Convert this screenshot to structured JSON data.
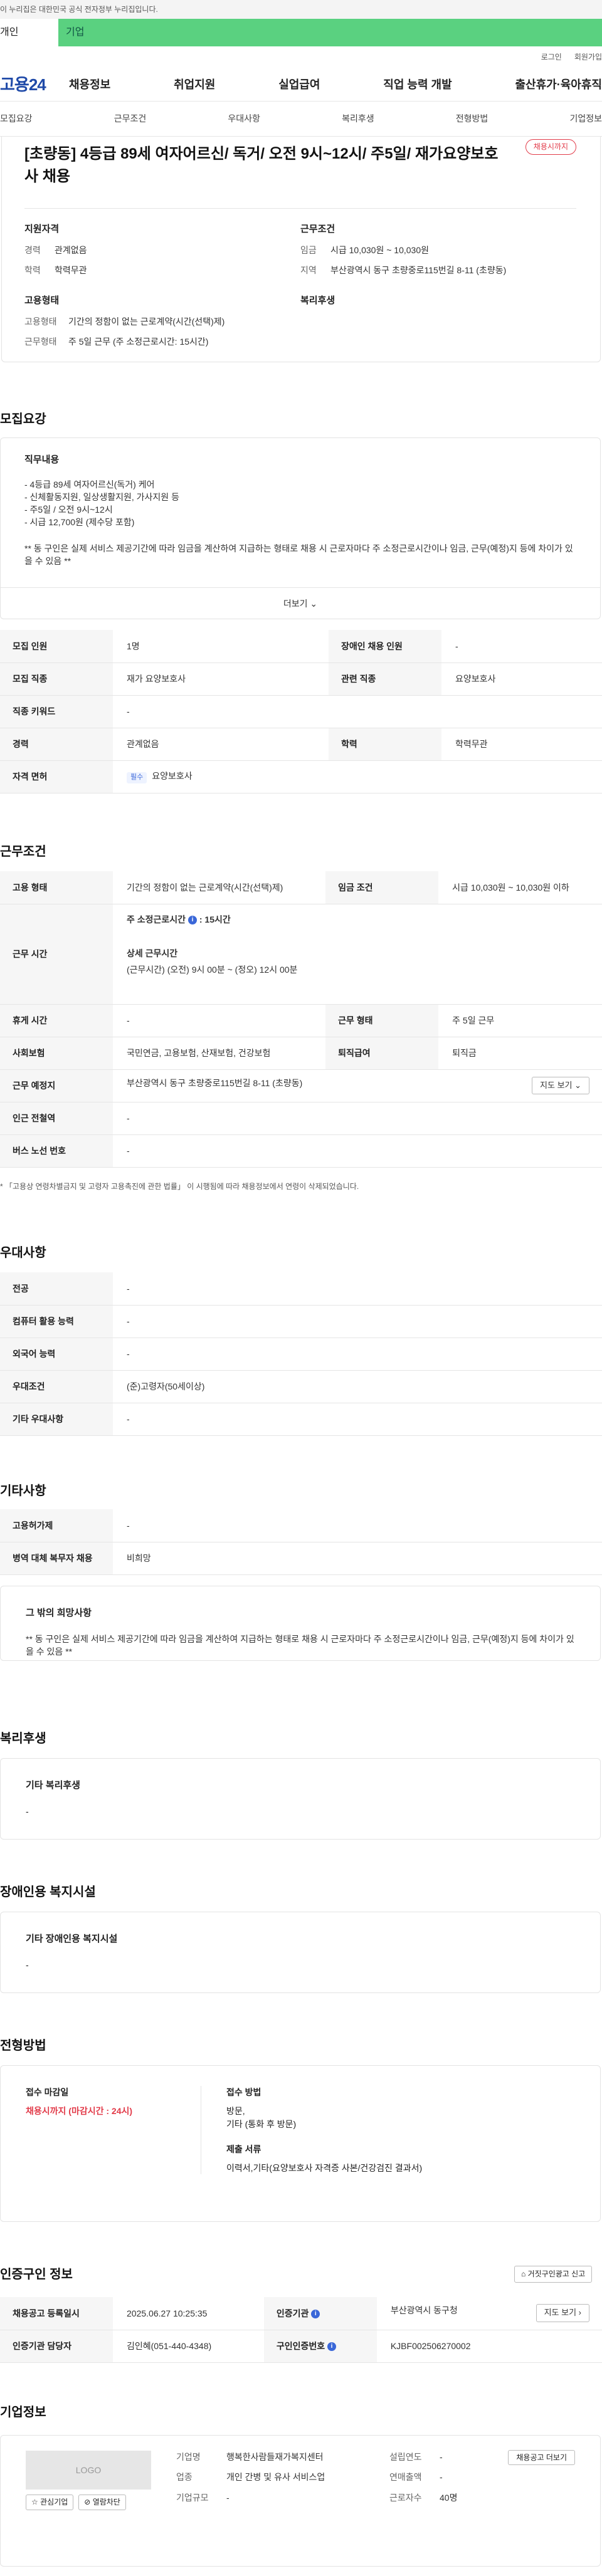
{
  "gov_banner": "이 누리집은 대한민국 공식 전자정부 누리집입니다.",
  "usertype": {
    "individual": "개인",
    "business": "기업"
  },
  "util": {
    "login": "로그인",
    "join": "회원가입"
  },
  "gnb": {
    "logo": "고용24",
    "menu": [
      "채용정보",
      "취업지원",
      "실업급여",
      "직업 능력 개발",
      "출산휴가·육아휴직"
    ]
  },
  "subnav": [
    "모집요강",
    "근무조건",
    "우대사항",
    "복리후생",
    "전형방법",
    "기업정보"
  ],
  "hero": {
    "title": "[초량동] 4등급 89세 여자어르신/ 독거/ 오전 9시~12시/ 주5일/ 재가요양보호사 채용",
    "badge": "채용시까지",
    "applicant": {
      "heading": "지원자격",
      "rows": [
        {
          "k": "경력",
          "v": "관계없음"
        },
        {
          "k": "학력",
          "v": "학력무관"
        }
      ]
    },
    "condition": {
      "heading": "근무조건",
      "rows": [
        {
          "k": "임금",
          "v": "시급 10,030원 ~ 10,030원"
        },
        {
          "k": "지역",
          "v": "부산광역시 동구 초량중로115번길 8-11 (초량동)"
        }
      ]
    },
    "employ": {
      "heading": "고용형태",
      "rows": [
        {
          "k": "고용형태",
          "v": "기간의 정함이 없는 근로계약(시간(선택)제)"
        },
        {
          "k": "근무형태",
          "v": "주 5일 근무 (주 소정근로시간: 15시간)"
        }
      ]
    },
    "welfare": {
      "heading": "복리후생"
    }
  },
  "recruit": {
    "title": "모집요강",
    "job_desc_title": "직무내용",
    "job_desc_lines": [
      "- 4등급 89세 여자어르신(독거) 케어",
      "- 신체활동지원, 일상생활지원, 가사지원 등",
      "- 주5일 / 오전 9시~12시",
      "- 시급 12,700원 (제수당 포함)",
      "",
      "** 동 구인은 실제 서비스 제공기간에 따라 임금을 계산하여 지급하는 형태로 채용 시 근로자마다 주 소정근로시간이나 임금, 근무(예정)지 등에 차이가 있을 수 있음 **"
    ],
    "more": "더보기",
    "table": [
      {
        "k1": "모집 인원",
        "v1": "1명",
        "k2": "장애인 채용 인원",
        "v2": "-"
      },
      {
        "k1": "모집 직종",
        "v1": "재가 요양보호사",
        "k2": "관련 직종",
        "v2": "요양보호사"
      },
      {
        "k1": "직종 키워드",
        "v1": "-"
      },
      {
        "k1": "경력",
        "v1": "관계없음",
        "k2": "학력",
        "v2": "학력무관"
      },
      {
        "k1": "자격 면허",
        "tag": "필수",
        "v1": "요양보호사"
      }
    ]
  },
  "work": {
    "title": "근무조건",
    "employ_type_k": "고용 형태",
    "employ_type_v": "기간의 정함이 없는 근로계약(시간(선택)제)",
    "wage_k": "임금 조건",
    "wage_v": "시급 10,030원 ~ 10,030원 이하",
    "hours_k": "근무 시간",
    "hours_weekly_label": "주 소정근로시간",
    "hours_weekly_value": "15시간",
    "hours_detail_label": "상세 근무시간",
    "hours_detail_value": "(근무시간) (오전) 9시 00분 ~ (정오) 12시 00분",
    "rest_k": "휴게 시간",
    "rest_v": "-",
    "form_k": "근무 형태",
    "form_v": "주 5일 근무",
    "insurance_k": "사회보험",
    "insurance_v": "국민연금, 고용보험, 산재보험, 건강보험",
    "severance_k": "퇴직급여",
    "severance_v": "퇴직금",
    "place_k": "근무 예정지",
    "place_v": "부산광역시 동구 초량중로115번길 8-11 (초량동)",
    "map_btn": "지도 보기",
    "industry_k": "인근 전철역",
    "industry_v": "-",
    "bus_k": "버스 노선 번호",
    "bus_v": "-",
    "note": "* 「고용상 연령차별금지 및 고령자 고용촉진에 관한 법률」 이 시행됨에 따라 채용정보에서 연령이 삭제되었습니다."
  },
  "preference": {
    "title": "우대사항",
    "rows": [
      {
        "k": "전공",
        "v": "-"
      },
      {
        "k": "컴퓨터 활용 능력",
        "v": "-"
      },
      {
        "k": "외국어 능력",
        "v": "-"
      },
      {
        "k": "우대조건",
        "v": "(준)고령자(50세이상)"
      },
      {
        "k": "기타 우대사항",
        "v": "-"
      }
    ]
  },
  "etc": {
    "title": "기타사항",
    "rows": [
      {
        "k": "고용허가제",
        "v": "-"
      },
      {
        "k": "병역 대체 복무자 채용",
        "v": "비희망"
      }
    ],
    "hope_title": "그 밖의 희망사항",
    "hope_text": "** 동 구인은 실제 서비스 제공기간에 따라 임금을 계산하여 지급하는 형태로 채용 시 근로자마다 주 소정근로시간이나 임금, 근무(예정)지 등에 차이가 있을 수 있음 **"
  },
  "welfare": {
    "title": "복리후생",
    "sub": "기타 복리후생",
    "value": "-"
  },
  "disabled": {
    "title": "장애인용 복지시설",
    "sub": "기타 장애인용 복지시설",
    "value": "-"
  },
  "selection": {
    "title": "전형방법",
    "deadline_label": "접수 마감일",
    "deadline_value": "채용시까지 (마감시간 : 24시)",
    "method_label": "접수 방법",
    "method_value_1": "방문,",
    "method_value_2": "기타 (통화 후 방문)",
    "docs_label": "제출 서류",
    "docs_value": "이력서,기타(요양보호사 자격증 사본/건강검진 결과서)"
  },
  "cert": {
    "title": "인증구인 정보",
    "report_btn": "거짓구인광고 신고",
    "rows": [
      {
        "k1": "채용공고 등록일시",
        "v1": "2025.06.27 10:25:35",
        "k2": "인증기관",
        "v2": "부산광역시 동구청",
        "btn": "지도 보기"
      },
      {
        "k1": "인증기관 담당자",
        "v1": "김인혜(051-440-4348)",
        "k2": "구인인증번호",
        "v2": "KJBF002506270002"
      }
    ]
  },
  "company": {
    "title": "기업정보",
    "logo": "LOGO",
    "interest_btn": "관심기업",
    "block_btn": "열람차단",
    "industry_k": "기업명",
    "industry_v": "행복한사람들재가복지센터",
    "biz_k": "업종",
    "biz_v": "개인 간병 및 유사 서비스업",
    "scale_k": "기업규모",
    "scale_v": "-",
    "founded_k": "설립연도",
    "founded_v": "-",
    "sales_k": "연매출액",
    "sales_v": "-",
    "staff_k": "근로자수",
    "staff_v": "40명",
    "recruit_btn": "채용공고 더보기"
  }
}
